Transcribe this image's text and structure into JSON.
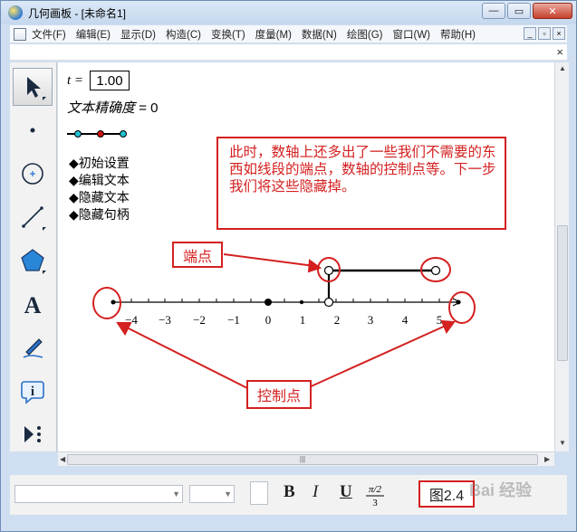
{
  "window": {
    "title": "几何画板 - [未命名1]",
    "controls": {
      "minimize": "—",
      "restore": "▭",
      "close": "✕"
    }
  },
  "menu": {
    "items": [
      "文件(F)",
      "编辑(E)",
      "显示(D)",
      "构造(C)",
      "变换(T)",
      "度量(M)",
      "数据(N)",
      "绘图(G)",
      "窗口(W)",
      "帮助(H)"
    ],
    "mdi_controls": [
      "_",
      "▫",
      "×"
    ]
  },
  "doc": {
    "close": "×"
  },
  "canvas": {
    "t_label": "t =",
    "t_value": "1.00",
    "precision_label": "文本精确度",
    "precision_value": "= 0",
    "action_buttons": [
      "◆初始设置",
      "◆编辑文本",
      "◆隐藏文本",
      "◆隐藏句柄"
    ],
    "callout_text": "此时，数轴上还多出了一些我们不需要的东西如线段的端点，数轴的控制点等。下一步我们将这些隐藏掉。",
    "endpoint_label": "端点",
    "control_point_label": "控制点",
    "axis_ticks": [
      "−4",
      "−3",
      "−2",
      "−1",
      "0",
      "1",
      "2",
      "3",
      "4",
      "5"
    ]
  },
  "bottom": {
    "bold": "B",
    "italic": "I",
    "underline": "U",
    "figure_label": "图2.4",
    "watermark": "Bai 经验"
  },
  "colors": {
    "accent_red": "#d42020",
    "slider_cyan": "#20c0d0",
    "slider_red": "#d01010"
  }
}
